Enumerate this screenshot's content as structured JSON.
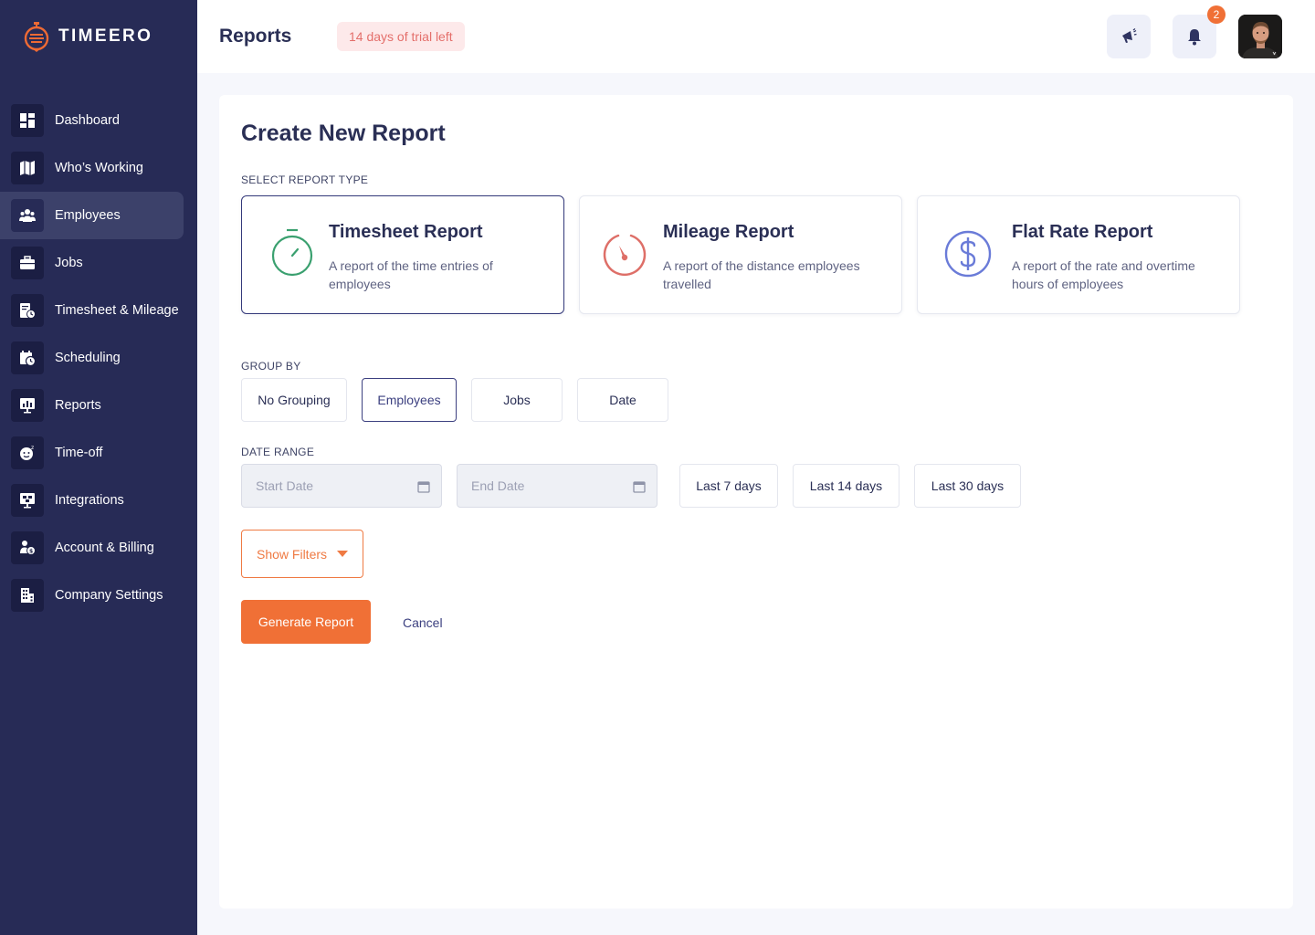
{
  "app": {
    "brand": "TIMEERO"
  },
  "sidebar": {
    "items": [
      {
        "label": "Dashboard",
        "icon": "dashboard-icon"
      },
      {
        "label": "Who’s Working",
        "icon": "map-icon"
      },
      {
        "label": "Employees",
        "icon": "employees-icon",
        "active": true
      },
      {
        "label": "Jobs",
        "icon": "briefcase-icon"
      },
      {
        "label": "Timesheet & Mileage",
        "icon": "timesheet-icon"
      },
      {
        "label": "Scheduling",
        "icon": "calendar-clock-icon"
      },
      {
        "label": "Reports",
        "icon": "reports-icon"
      },
      {
        "label": "Time-off",
        "icon": "time-off-icon"
      },
      {
        "label": "Integrations",
        "icon": "integrations-icon"
      },
      {
        "label": "Account & Billing",
        "icon": "account-billing-icon"
      },
      {
        "label": "Company Settings",
        "icon": "building-icon"
      }
    ]
  },
  "header": {
    "title": "Reports",
    "trial_badge": "14 days of trial left",
    "notification_count": "2"
  },
  "main": {
    "title": "Create New Report",
    "report_type_label": "SELECT REPORT TYPE",
    "report_types": [
      {
        "title": "Timesheet Report",
        "desc1": "A report of the time entries of",
        "desc2": "employees",
        "icon": "stopwatch-icon",
        "color": "#3aa06f",
        "selected": true
      },
      {
        "title": "Mileage Report",
        "desc1": "A report of the distance employees",
        "desc2": "travelled",
        "icon": "speedometer-icon",
        "color": "#de6f68"
      },
      {
        "title": "Flat Rate Report",
        "desc1": "A report of the rate and overtime",
        "desc2": "hours of employees",
        "icon": "dollar-icon",
        "color": "#6a7bd8"
      }
    ],
    "group_by_label": "GROUP BY",
    "group_by_options": [
      "No Grouping",
      "Employees",
      "Jobs",
      "Date"
    ],
    "group_by_selected": "Employees",
    "date_range_label": "DATE RANGE",
    "start_date_placeholder": "Start Date",
    "end_date_placeholder": "End Date",
    "date_presets": [
      "Last 7 days",
      "Last 14 days",
      "Last 30 days"
    ],
    "show_filters": "Show Filters",
    "generate_button": "Generate Report",
    "cancel_link": "Cancel"
  },
  "colors": {
    "sidebar_bg": "#272b56",
    "accent_orange": "#f07036",
    "primary_navy": "#2a2f55"
  }
}
